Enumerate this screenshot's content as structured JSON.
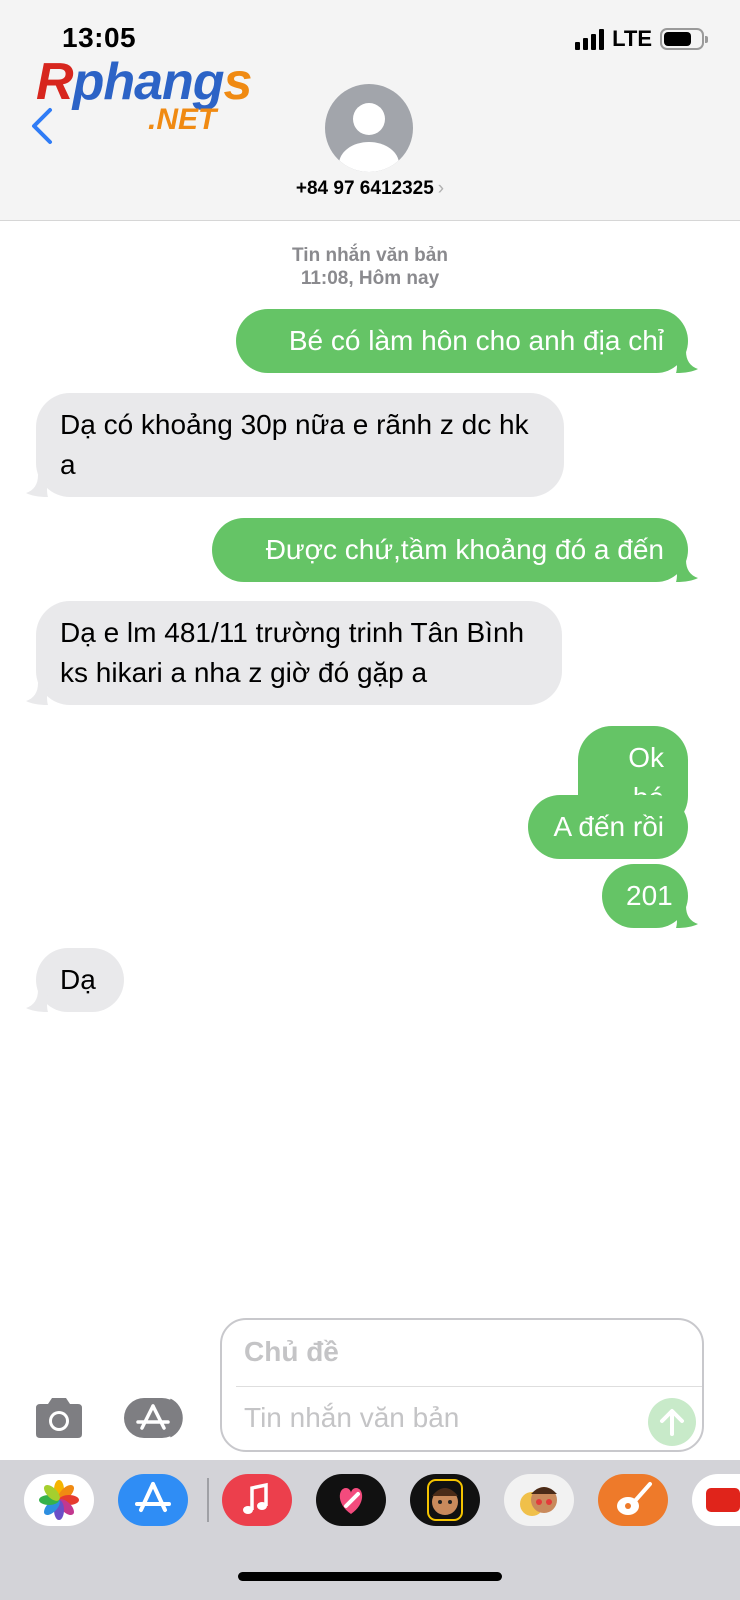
{
  "status_bar": {
    "time": "13:05",
    "network": "LTE",
    "battery_level": 0.75
  },
  "header": {
    "logo_text": "Rphangs",
    "logo_suffix": ".NET",
    "contact": "+84 97 6412325",
    "chevron": "›"
  },
  "thread": {
    "meta_line1": "Tin nhắn văn bản",
    "meta_line2": "11:08, Hôm nay",
    "messages": [
      {
        "direction": "out",
        "text": "Bé có làm hôn cho anh địa chỉ"
      },
      {
        "direction": "in",
        "text": "Dạ có khoảng 30p nữa e rãnh z dc hk a"
      },
      {
        "direction": "out",
        "text": "Được chứ,tầm khoảng đó a đến"
      },
      {
        "direction": "in",
        "text": "Dạ e lm 481/11 trường trinh Tân Bình ks hikari a nha z giờ đó gặp a"
      },
      {
        "direction": "out",
        "text": "Ok bé"
      },
      {
        "direction": "out",
        "text": "A đến rồi"
      },
      {
        "direction": "out",
        "text": "201"
      },
      {
        "direction": "in",
        "text": "Dạ"
      }
    ]
  },
  "composer": {
    "subject_placeholder": "Chủ đề",
    "body_placeholder": "Tin nhắn văn bản"
  },
  "app_drawer": {
    "apps": [
      "photos-icon",
      "app-store-icon",
      "music-icon",
      "digital-touch-icon",
      "memoji-icon",
      "memoji-stickers-icon",
      "garageband-icon",
      "more-app-icon"
    ]
  },
  "colors": {
    "outgoing": "#65c466",
    "incoming": "#e9e9eb",
    "accent": "#2f7cf6"
  }
}
